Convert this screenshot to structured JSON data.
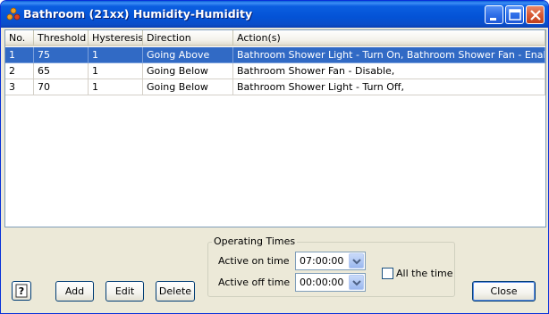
{
  "window": {
    "title": "Bathroom (21xx) Humidity-Humidity",
    "controls": [
      "minimize",
      "maximize",
      "close"
    ]
  },
  "table": {
    "columns": [
      "No.",
      "Threshold",
      "Hysteresis",
      "Direction",
      "Action(s)"
    ],
    "rows": [
      [
        "1",
        "75",
        "1",
        "Going Above",
        "Bathroom Shower Light - Turn On, Bathroom Shower Fan - Enable,"
      ],
      [
        "2",
        "65",
        "1",
        "Going Below",
        "Bathroom Shower Fan - Disable,"
      ],
      [
        "3",
        "70",
        "1",
        "Going Below",
        "Bathroom Shower Light - Turn Off,"
      ]
    ],
    "selected_row": 0
  },
  "operating_times": {
    "legend": "Operating Times",
    "on_label": "Active on time",
    "on_value": "07:00:00",
    "off_label": "Active off time",
    "off_value": "00:00:00",
    "all_time_label": "All the time",
    "all_time_checked": false
  },
  "buttons": {
    "help": "?",
    "add": "Add",
    "edit": "Edit",
    "delete": "Delete",
    "close": "Close"
  },
  "icons": {
    "app": "app-nodes-icon",
    "help": "help-icon"
  },
  "colors": {
    "selection": "#316ac5",
    "titlebar": "#0453d6",
    "face": "#ece9d8"
  }
}
